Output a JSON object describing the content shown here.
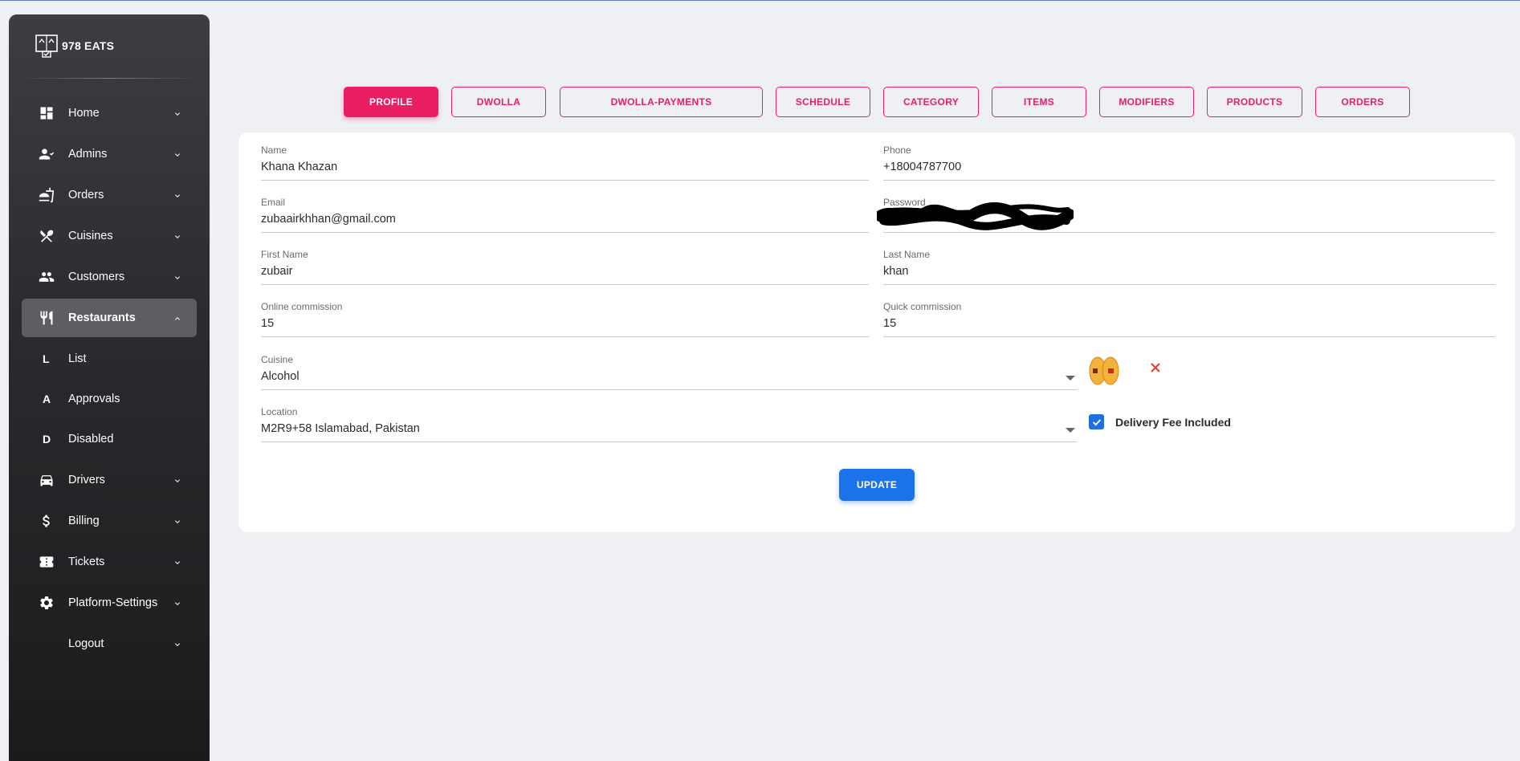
{
  "brand": {
    "name": "978 EATS",
    "icon": "logo-icon"
  },
  "sidebar": {
    "items": [
      {
        "label": "Home",
        "icon": "dashboard-icon"
      },
      {
        "label": "Admins",
        "icon": "admins-icon"
      },
      {
        "label": "Orders",
        "icon": "orders-icon"
      },
      {
        "label": "Cuisines",
        "icon": "cuisines-icon"
      },
      {
        "label": "Customers",
        "icon": "customers-icon"
      },
      {
        "label": "Restaurants",
        "icon": "restaurants-icon",
        "active": true
      },
      {
        "label": "Drivers",
        "icon": "car-icon"
      },
      {
        "label": "Billing",
        "icon": "dollar-icon"
      },
      {
        "label": "Tickets",
        "icon": "ticket-icon"
      },
      {
        "label": "Platform-Settings",
        "icon": "gear-icon"
      },
      {
        "label": "Logout",
        "icon": ""
      }
    ],
    "restaurant_subitems": [
      {
        "letter": "L",
        "label": "List"
      },
      {
        "letter": "A",
        "label": "Approvals"
      },
      {
        "letter": "D",
        "label": "Disabled"
      }
    ]
  },
  "tabs": [
    {
      "label": "PROFILE",
      "active": true
    },
    {
      "label": "DWOLLA"
    },
    {
      "label": "DWOLLA-PAYMENTS"
    },
    {
      "label": "SCHEDULE"
    },
    {
      "label": "CATEGORY"
    },
    {
      "label": "ITEMS"
    },
    {
      "label": "MODIFIERS"
    },
    {
      "label": "PRODUCTS"
    },
    {
      "label": "ORDERS"
    }
  ],
  "form": {
    "name": {
      "label": "Name",
      "value": "Khana Khazan"
    },
    "phone": {
      "label": "Phone",
      "value": "+18004787700"
    },
    "email": {
      "label": "Email",
      "value": "zubaairkhhan@gmail.com"
    },
    "password": {
      "label": "Password",
      "value": ""
    },
    "first_name": {
      "label": "First Name",
      "value": "zubair"
    },
    "last_name": {
      "label": "Last Name",
      "value": "khan"
    },
    "online_commission": {
      "label": "Online commission",
      "value": "15"
    },
    "quick_commission": {
      "label": "Quick commission",
      "value": "15"
    },
    "cuisine": {
      "label": "Cuisine",
      "value": "Alcohol"
    },
    "location": {
      "label": "Location",
      "value": "M2R9+58 Islamabad, Pakistan"
    },
    "delivery_fee_included": {
      "label": "Delivery Fee Included",
      "checked": true
    },
    "update_label": "UPDATE"
  },
  "colors": {
    "accent": "#e91e63",
    "primary": "#1a73e8",
    "sidebar": "#2a2a2e",
    "background": "#eef0f4"
  }
}
